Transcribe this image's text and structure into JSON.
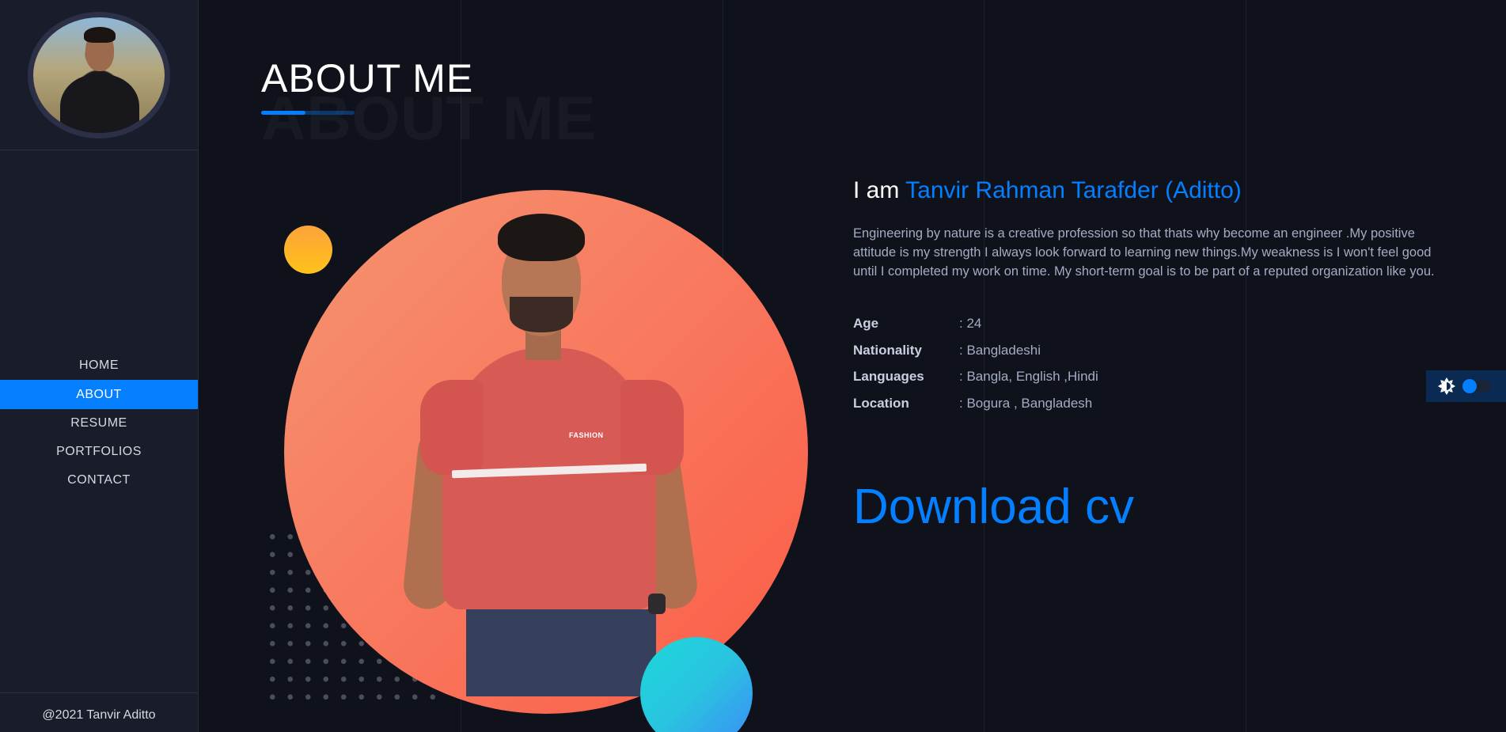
{
  "sidebar": {
    "nav": [
      "HOME",
      "ABOUT",
      "RESUME",
      "PORTFOLIOS",
      "CONTACT"
    ],
    "active": "ABOUT",
    "footer": "@2021 Tanvir Aditto"
  },
  "main": {
    "title": "ABOUT ME",
    "title_shadow": "ABOUT ME",
    "intro_prefix": "I am ",
    "intro_name": "Tanvir Rahman Tarafder (Aditto)",
    "description": "Engineering by nature is a creative profession so that thats why become an engineer .My positive attitude is my strength I always look forward to learning new things.My weakness is I won't feel good until I completed my work on time. My short-term goal is to be part of a reputed organization like you.",
    "info": [
      {
        "label": "Age",
        "value": ": 24"
      },
      {
        "label": "Nationality",
        "value": ": Bangladeshi"
      },
      {
        "label": "Languages",
        "value": ": Bangla, English ,Hindi"
      },
      {
        "label": "Location",
        "value": ": Bogura , Bangladesh"
      }
    ],
    "download_label": "Download cv",
    "shirt_brand": "FASHION"
  },
  "colors": {
    "accent": "#037fff",
    "background": "#10121b",
    "sidebar": "#191c2a"
  },
  "icons": {
    "theme": "brightness-icon"
  }
}
